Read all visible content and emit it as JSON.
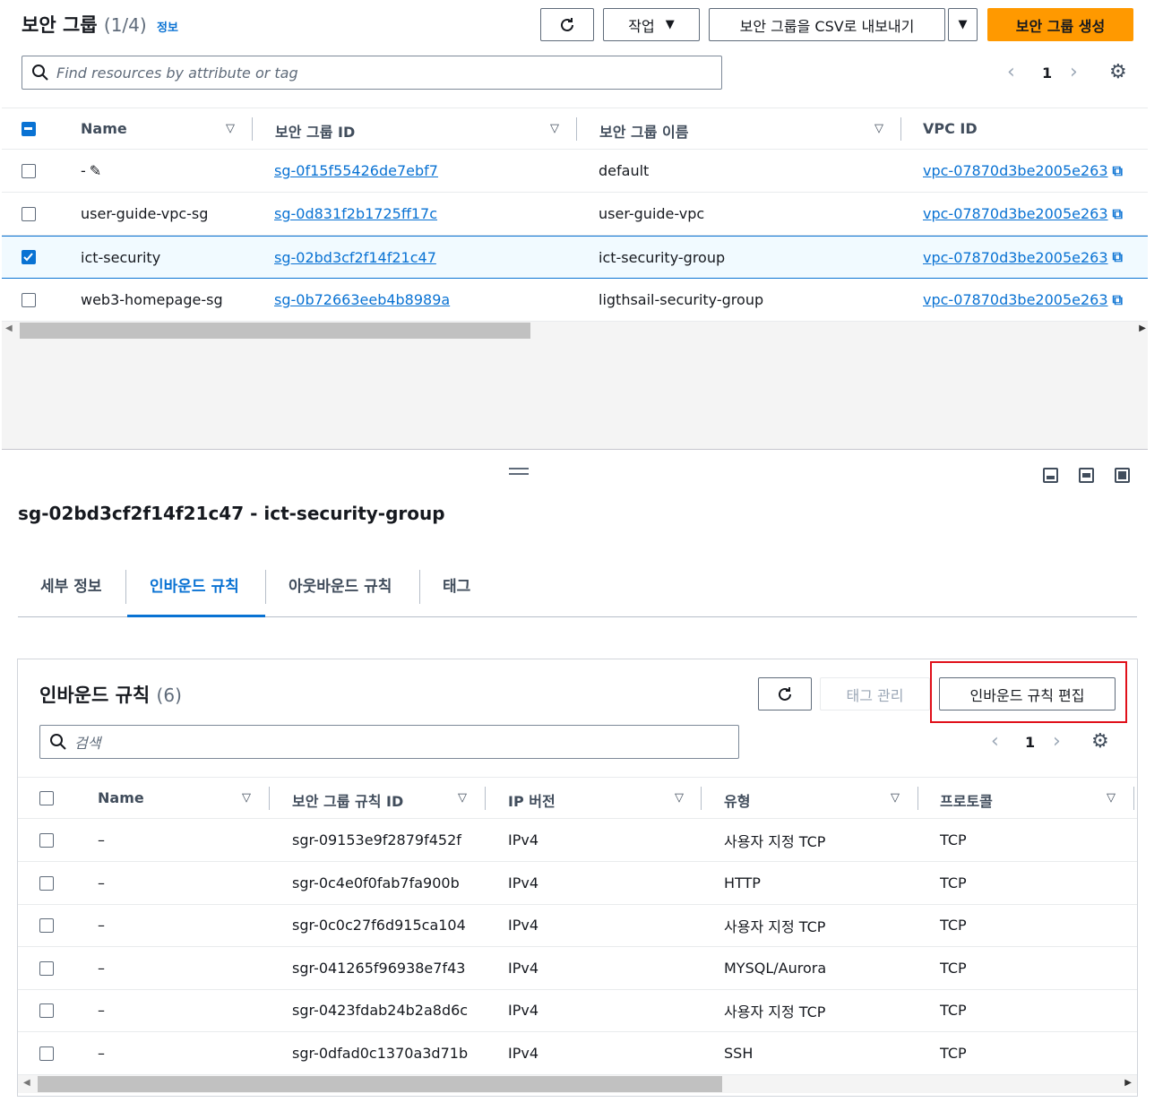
{
  "top": {
    "title": "보안 그룹",
    "count": "(1/4)",
    "info_link": "정보",
    "actions_label": "작업",
    "export_label": "보안 그룹을 CSV로 내보내기",
    "create_label": "보안 그룹 생성",
    "search_placeholder": "Find resources by attribute or tag",
    "page": "1",
    "columns": [
      "Name",
      "보안 그룹 ID",
      "보안 그룹 이름",
      "VPC ID"
    ],
    "rows": [
      {
        "name": "-",
        "sg_id": "sg-0f15f55426de7ebf7",
        "sg_name": "default",
        "vpc": "vpc-07870d3be2005e263",
        "selected": false
      },
      {
        "name": "user-guide-vpc-sg",
        "sg_id": "sg-0d831f2b1725ff17c",
        "sg_name": "user-guide-vpc",
        "vpc": "vpc-07870d3be2005e263",
        "selected": false
      },
      {
        "name": "ict-security",
        "sg_id": "sg-02bd3cf2f14f21c47",
        "sg_name": "ict-security-group",
        "vpc": "vpc-07870d3be2005e263",
        "selected": true
      },
      {
        "name": "web3-homepage-sg",
        "sg_id": "sg-0b72663eeb4b8989a",
        "sg_name": "ligthsail-security-group",
        "vpc": "vpc-07870d3be2005e263",
        "selected": false
      }
    ]
  },
  "detail": {
    "heading": "sg-02bd3cf2f14f21c47 - ict-security-group",
    "tabs": [
      "세부 정보",
      "인바운드 규칙",
      "아웃바운드 규칙",
      "태그"
    ],
    "active_tab": 1
  },
  "inbound": {
    "title": "인바운드 규칙",
    "count": "(6)",
    "manage_tags_label": "태그 관리",
    "edit_label": "인바운드 규칙 편집",
    "search_placeholder": "검색",
    "page": "1",
    "columns": [
      "Name",
      "보안 그룹 규칙 ID",
      "IP 버전",
      "유형",
      "프로토콜"
    ],
    "rows": [
      {
        "name": "–",
        "rule_id": "sgr-09153e9f2879f452f",
        "ip": "IPv4",
        "type": "사용자 지정 TCP",
        "protocol": "TCP"
      },
      {
        "name": "–",
        "rule_id": "sgr-0c4e0f0fab7fa900b",
        "ip": "IPv4",
        "type": "HTTP",
        "protocol": "TCP"
      },
      {
        "name": "–",
        "rule_id": "sgr-0c0c27f6d915ca104",
        "ip": "IPv4",
        "type": "사용자 지정 TCP",
        "protocol": "TCP"
      },
      {
        "name": "–",
        "rule_id": "sgr-041265f96938e7f43",
        "ip": "IPv4",
        "type": "MYSQL/Aurora",
        "protocol": "TCP"
      },
      {
        "name": "–",
        "rule_id": "sgr-0423fdab24b2a8d6c",
        "ip": "IPv4",
        "type": "사용자 지정 TCP",
        "protocol": "TCP"
      },
      {
        "name": "–",
        "rule_id": "sgr-0dfad0c1370a3d71b",
        "ip": "IPv4",
        "type": "SSH",
        "protocol": "TCP"
      }
    ]
  },
  "colors": {
    "accent": "#0972d3",
    "primary": "#ff9900",
    "highlight": "#e0101a"
  }
}
